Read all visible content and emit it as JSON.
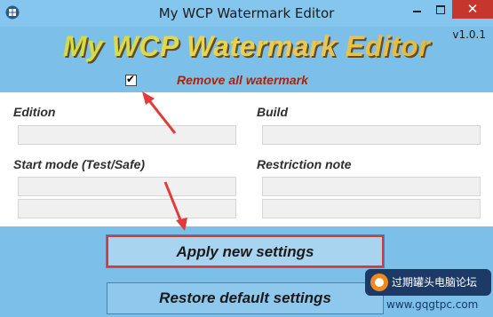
{
  "window": {
    "title": "My WCP Watermark Editor",
    "close_glyph": "✕"
  },
  "header": {
    "banner": "My WCP Watermark Editor",
    "version": "v1.0.1"
  },
  "remove_all": {
    "checked": true,
    "check_glyph": "✔",
    "label": "Remove all watermark"
  },
  "form": {
    "edition_label": "Edition",
    "build_label": "Build",
    "start_mode_label": "Start mode (Test/Safe)",
    "restriction_label": "Restriction note",
    "edition_value": "",
    "build_value": "",
    "start_mode_line1": "",
    "start_mode_line2": "",
    "restriction_line1": "",
    "restriction_line2": ""
  },
  "buttons": {
    "apply": "Apply new settings",
    "restore": "Restore default settings"
  },
  "watermark_logo": {
    "title": "过期罐头电脑论坛",
    "url": "www.gqgtpc.com"
  },
  "colors": {
    "window_bg": "#7cc0ea",
    "panel_bg": "#ffffff",
    "accent_red": "#d43a3a",
    "remove_label": "#a8240b",
    "close_button": "#c7362d"
  }
}
